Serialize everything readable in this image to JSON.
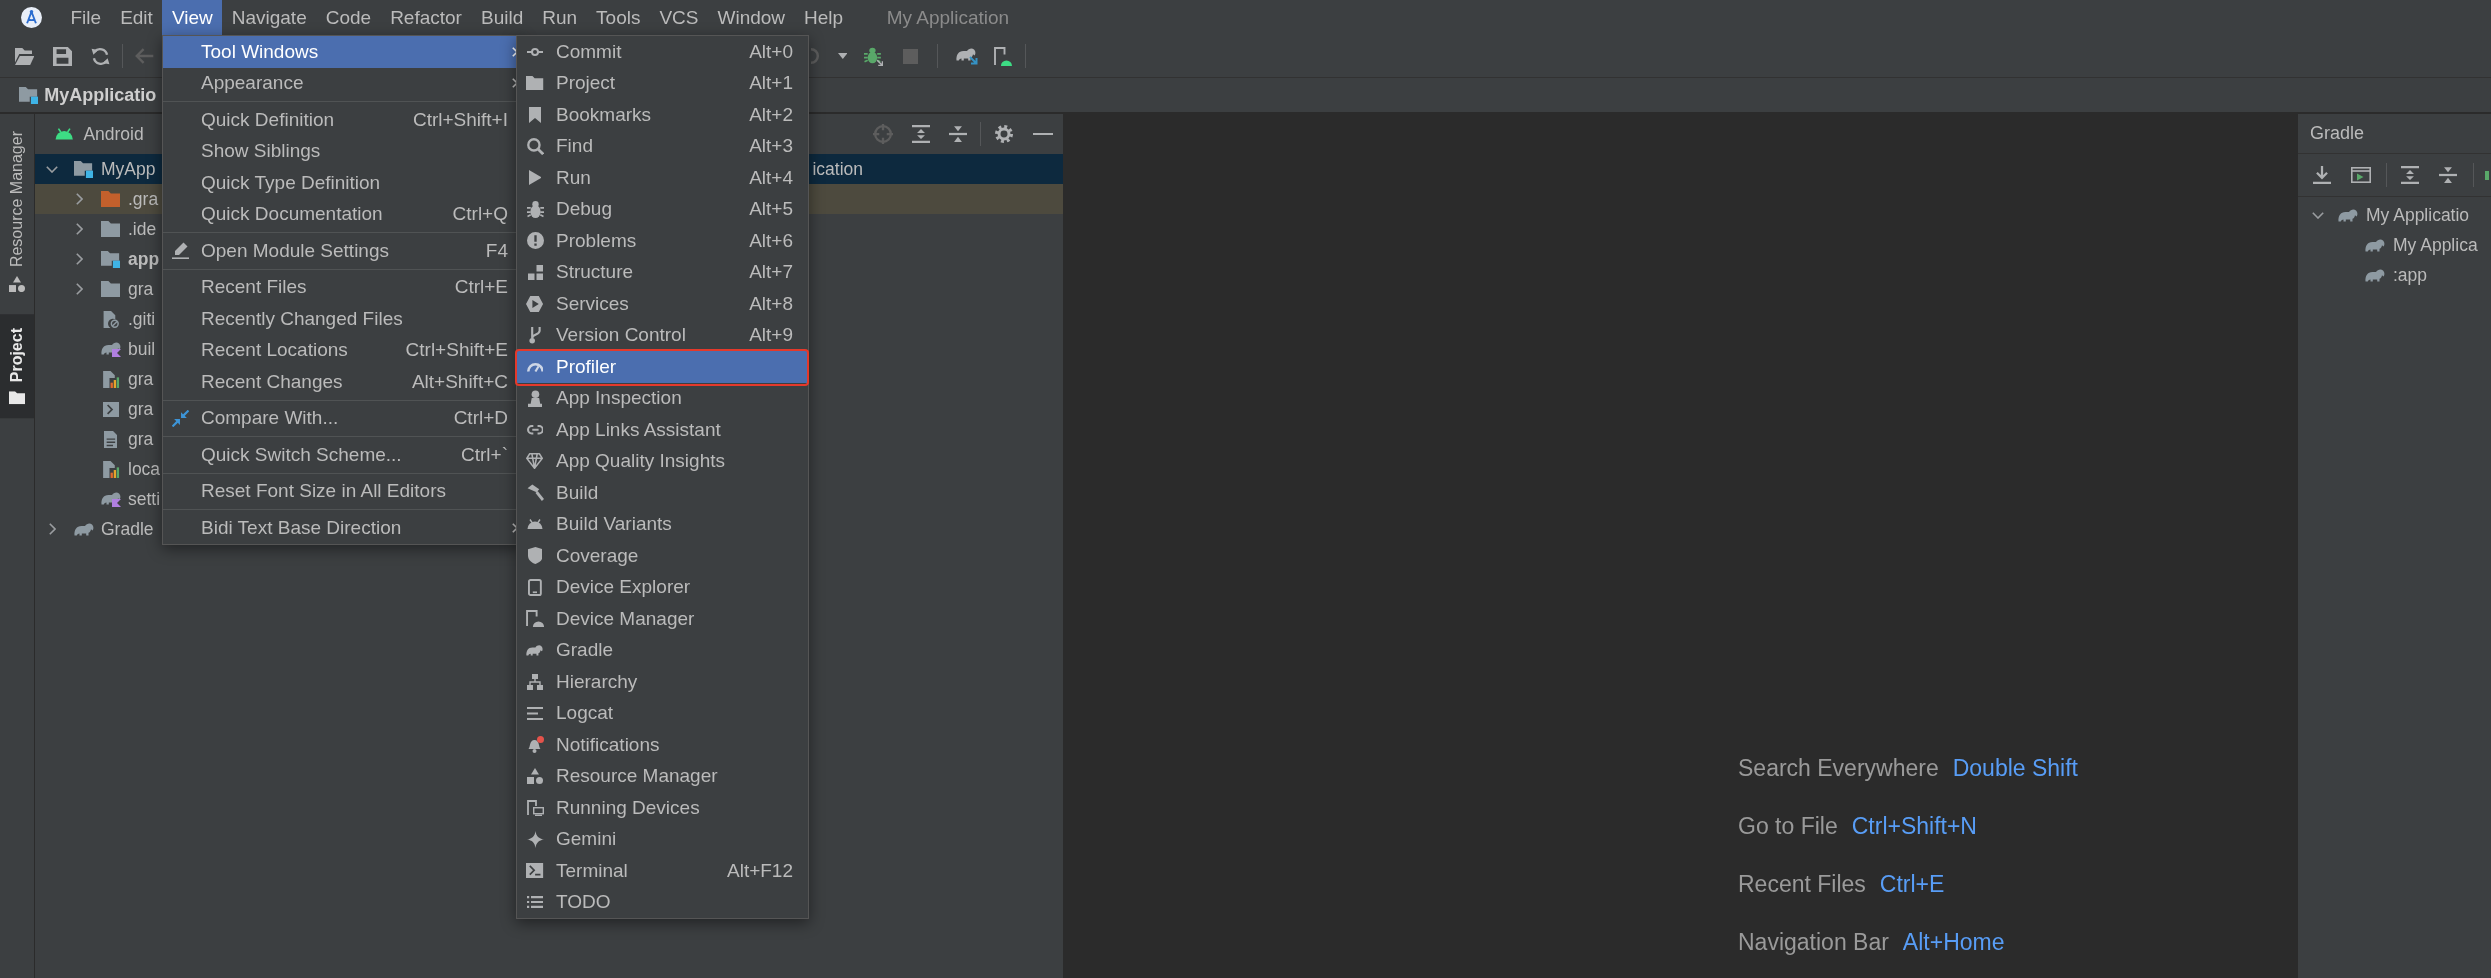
{
  "menu_bar": {
    "items": [
      {
        "label": "File",
        "selected": false
      },
      {
        "label": "Edit",
        "selected": false
      },
      {
        "label": "View",
        "selected": true
      },
      {
        "label": "Navigate",
        "selected": false
      },
      {
        "label": "Code",
        "selected": false
      },
      {
        "label": "Refactor",
        "selected": false
      },
      {
        "label": "Build",
        "selected": false
      },
      {
        "label": "Run",
        "selected": false
      },
      {
        "label": "Tools",
        "selected": false
      },
      {
        "label": "VCS",
        "selected": false
      },
      {
        "label": "Window",
        "selected": false
      },
      {
        "label": "Help",
        "selected": false
      }
    ],
    "title": "My Application"
  },
  "toolbar": {
    "left_buttons": [
      {
        "disabled": false
      },
      {
        "disabled": false
      },
      {
        "disabled": false
      },
      {
        "disabled": true
      }
    ],
    "right_buttons": [
      {
        "disabled": true
      },
      {
        "disabled": false
      },
      {
        "disabled": false
      },
      {
        "disabled": true
      },
      {
        "disabled": false
      },
      {
        "disabled": false
      }
    ]
  },
  "navigation_bar": {
    "label": "MyApplicatio"
  },
  "tool_stripe": {
    "tabs": [
      {
        "label": "Resource Manager",
        "selected": false
      },
      {
        "label": "Project",
        "selected": true
      }
    ]
  },
  "project_panel": {
    "view": "Android",
    "header_buttons": [
      {
        "disabled": true
      },
      {
        "disabled": false
      },
      {
        "disabled": false
      },
      {
        "disabled": false
      },
      {
        "disabled": false
      }
    ],
    "tree": [
      {
        "label": "MyApp",
        "label_end": "ication",
        "kind": "module",
        "expanded": true,
        "selected": true,
        "highlighted": false,
        "bold": false,
        "children": [
          {
            "label": ".gra",
            "kind": "excluded",
            "expanded": false,
            "selected": false,
            "highlighted": true,
            "bold": false
          },
          {
            "label": ".ide",
            "kind": "folder",
            "expanded": false,
            "selected": false,
            "highlighted": false,
            "bold": false
          },
          {
            "label": "app",
            "kind": "module",
            "expanded": false,
            "selected": false,
            "highlighted": false,
            "bold": true
          },
          {
            "label": "gra",
            "kind": "folder",
            "expanded": false,
            "selected": false,
            "highlighted": false,
            "bold": false
          },
          {
            "label": ".giti",
            "kind": "gitignore",
            "selected": false,
            "highlighted": false,
            "bold": false
          },
          {
            "label": "buil",
            "kind": "kotlinscript",
            "selected": false,
            "highlighted": false,
            "bold": false
          },
          {
            "label": "gra",
            "kind": "properties",
            "selected": false,
            "highlighted": false,
            "bold": false
          },
          {
            "label": "gra",
            "kind": "shell",
            "selected": false,
            "highlighted": false,
            "bold": false
          },
          {
            "label": "gra",
            "kind": "text",
            "selected": false,
            "highlighted": false,
            "bold": false
          },
          {
            "label": "loca",
            "kind": "properties",
            "selected": false,
            "highlighted": false,
            "bold": false
          },
          {
            "label": "setti",
            "kind": "kotlinscript",
            "selected": false,
            "highlighted": false,
            "bold": false
          }
        ]
      },
      {
        "label": "Gradle",
        "kind": "gradle",
        "expanded": false,
        "selected": false,
        "highlighted": false,
        "bold": false
      }
    ]
  },
  "view_menu": {
    "sections": [
      [
        {
          "label": "Tool Windows",
          "submenu": true,
          "selected": true
        },
        {
          "label": "Appearance",
          "submenu": true,
          "selected": false
        }
      ],
      [
        {
          "label": "Quick Definition",
          "shortcut": "Ctrl+Shift+I",
          "submenu": false,
          "selected": false
        },
        {
          "label": "Show Siblings",
          "submenu": false,
          "selected": false
        },
        {
          "label": "Quick Type Definition",
          "submenu": false,
          "selected": false
        },
        {
          "label": "Quick Documentation",
          "shortcut": "Ctrl+Q",
          "submenu": false,
          "selected": false
        }
      ],
      [
        {
          "label": "Open Module Settings",
          "shortcut": "F4",
          "submenu": false,
          "selected": false
        }
      ],
      [
        {
          "label": "Recent Files",
          "shortcut": "Ctrl+E",
          "submenu": false,
          "selected": false
        },
        {
          "label": "Recently Changed Files",
          "submenu": false,
          "selected": false
        },
        {
          "label": "Recent Locations",
          "shortcut": "Ctrl+Shift+E",
          "submenu": false,
          "selected": false
        },
        {
          "label": "Recent Changes",
          "shortcut": "Alt+Shift+C",
          "submenu": false,
          "selected": false
        }
      ],
      [
        {
          "label": "Compare With...",
          "shortcut": "Ctrl+D",
          "submenu": false,
          "selected": false
        }
      ],
      [
        {
          "label": "Quick Switch Scheme...",
          "shortcut": "Ctrl+`",
          "submenu": false,
          "selected": false
        }
      ],
      [
        {
          "label": "Reset Font Size in All Editors",
          "submenu": false,
          "selected": false
        }
      ],
      [
        {
          "label": "Bidi Text Base Direction",
          "submenu": true,
          "selected": false
        }
      ]
    ]
  },
  "tool_windows_menu": {
    "items": [
      {
        "label": "Commit",
        "shortcut": "Alt+0",
        "selected": false,
        "outlined": false
      },
      {
        "label": "Project",
        "shortcut": "Alt+1",
        "selected": false,
        "outlined": false
      },
      {
        "label": "Bookmarks",
        "shortcut": "Alt+2",
        "selected": false,
        "outlined": false
      },
      {
        "label": "Find",
        "shortcut": "Alt+3",
        "selected": false,
        "outlined": false
      },
      {
        "label": "Run",
        "shortcut": "Alt+4",
        "selected": false,
        "outlined": false
      },
      {
        "label": "Debug",
        "shortcut": "Alt+5",
        "selected": false,
        "outlined": false
      },
      {
        "label": "Problems",
        "shortcut": "Alt+6",
        "selected": false,
        "outlined": false
      },
      {
        "label": "Structure",
        "shortcut": "Alt+7",
        "selected": false,
        "outlined": false
      },
      {
        "label": "Services",
        "shortcut": "Alt+8",
        "selected": false,
        "outlined": false
      },
      {
        "label": "Version Control",
        "shortcut": "Alt+9",
        "selected": false,
        "outlined": false
      },
      {
        "label": "Profiler",
        "selected": true,
        "outlined": true
      },
      {
        "label": "App Inspection",
        "selected": false,
        "outlined": false
      },
      {
        "label": "App Links Assistant",
        "selected": false,
        "outlined": false
      },
      {
        "label": "App Quality Insights",
        "selected": false,
        "outlined": false
      },
      {
        "label": "Build",
        "selected": false,
        "outlined": false
      },
      {
        "label": "Build Variants",
        "selected": false,
        "outlined": false
      },
      {
        "label": "Coverage",
        "selected": false,
        "outlined": false
      },
      {
        "label": "Device Explorer",
        "selected": false,
        "outlined": false
      },
      {
        "label": "Device Manager",
        "selected": false,
        "outlined": false
      },
      {
        "label": "Gradle",
        "selected": false,
        "outlined": false
      },
      {
        "label": "Hierarchy",
        "selected": false,
        "outlined": false
      },
      {
        "label": "Logcat",
        "selected": false,
        "outlined": false
      },
      {
        "label": "Notifications",
        "selected": false,
        "outlined": false
      },
      {
        "label": "Resource Manager",
        "selected": false,
        "outlined": false
      },
      {
        "label": "Running Devices",
        "selected": false,
        "outlined": false
      },
      {
        "label": "Gemini",
        "selected": false,
        "outlined": false
      },
      {
        "label": "Terminal",
        "shortcut": "Alt+F12",
        "selected": false,
        "outlined": false
      },
      {
        "label": "TODO",
        "selected": false,
        "outlined": false
      }
    ]
  },
  "editor": {
    "hints": [
      {
        "action": "Search Everywhere",
        "shortcut": "Double Shift"
      },
      {
        "action": "Go to File",
        "shortcut": "Ctrl+Shift+N"
      },
      {
        "action": "Recent Files",
        "shortcut": "Ctrl+E"
      },
      {
        "action": "Navigation Bar",
        "shortcut": "Alt+Home"
      }
    ]
  },
  "gradle_panel": {
    "title": "Gradle",
    "tree": [
      {
        "label": "My Applicatio",
        "expanded": true,
        "children": [
          {
            "label": "My Applica"
          },
          {
            "label": ":app"
          }
        ]
      }
    ]
  }
}
